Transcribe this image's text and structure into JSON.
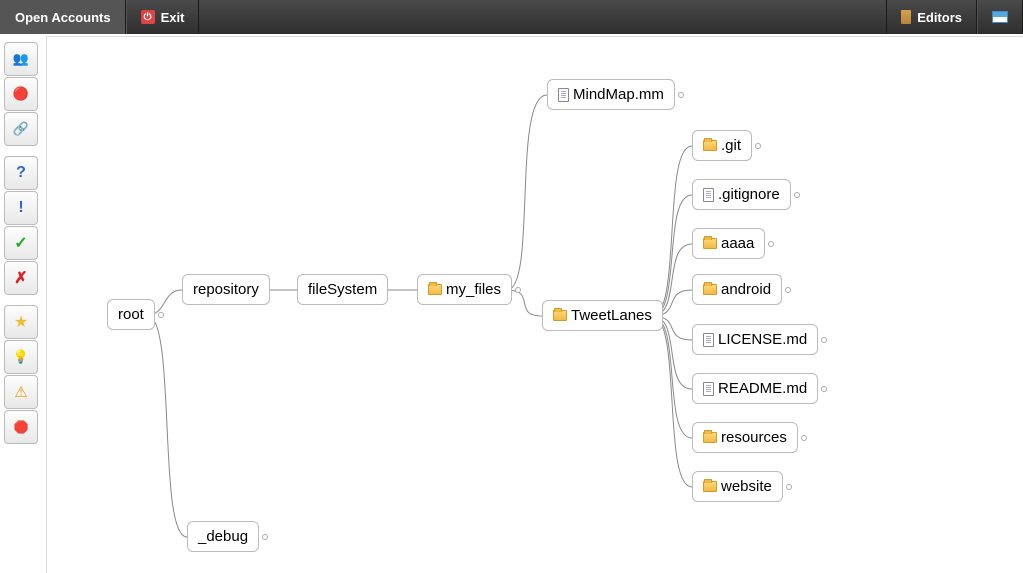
{
  "topbar": {
    "open_accounts": "Open Accounts",
    "exit": "Exit",
    "editors": "Editors"
  },
  "sidebar_icons": {
    "i1": "👥",
    "i2": "🔴",
    "i3": "🔗",
    "i4": "?",
    "i5": "!",
    "i6": "✓",
    "i7": "✗",
    "i8": "★",
    "i9": "💡",
    "i10": "⚠",
    "i11": "🛑"
  },
  "nodes": {
    "root": "root",
    "repository": "repository",
    "filesystem": "fileSystem",
    "my_files": "my_files",
    "debug": "_debug",
    "mindmap": "MindMap.mm",
    "tweetlanes": "TweetLanes",
    "git": ".git",
    "gitignore": ".gitignore",
    "aaaa": "aaaa",
    "android": "android",
    "license": "LICENSE.md",
    "readme": "README.md",
    "resources": "resources",
    "website": "website"
  }
}
